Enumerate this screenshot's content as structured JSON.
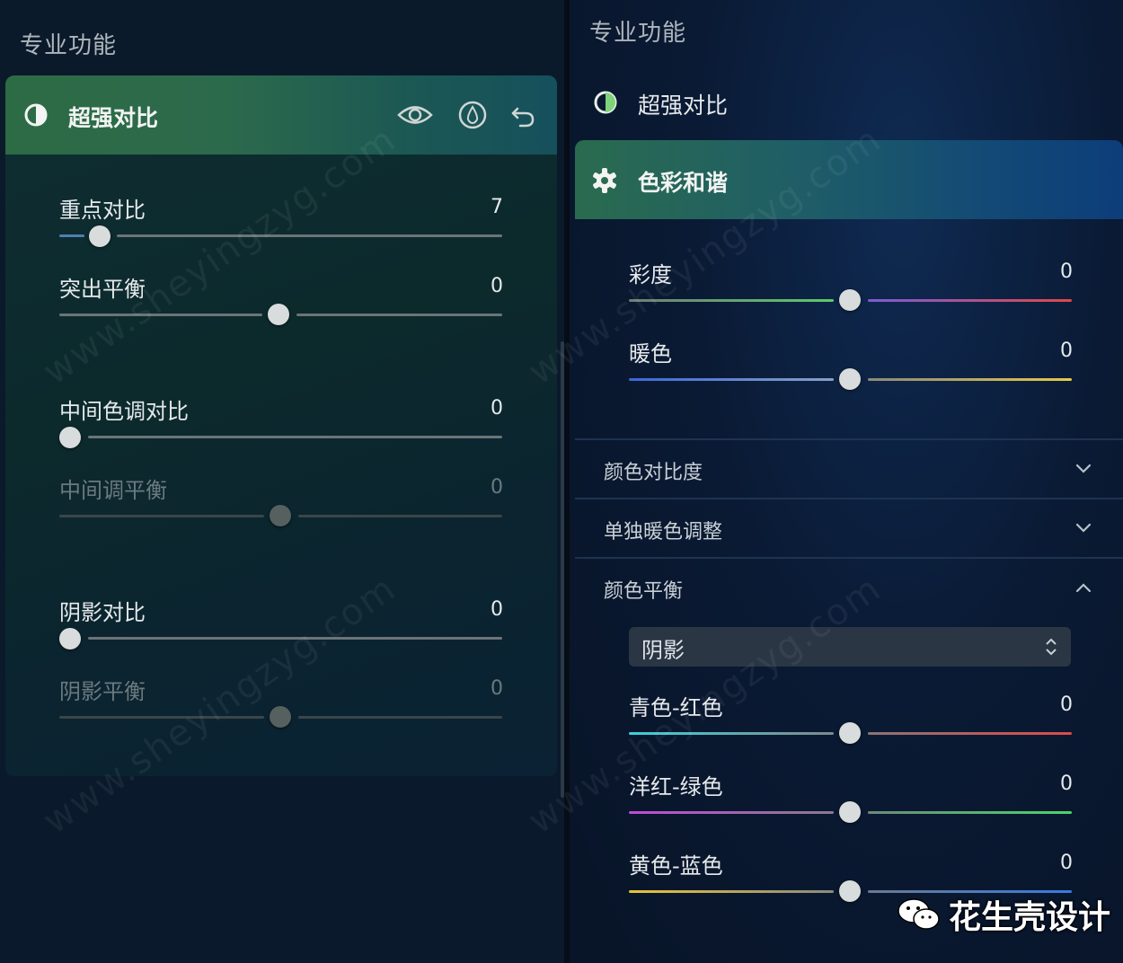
{
  "left": {
    "section_title": "专业功能",
    "panel_title": "超强对比",
    "sliders": [
      {
        "label": "重点对比",
        "value": "7",
        "enabled": true,
        "position": 0.09
      },
      {
        "label": "突出平衡",
        "value": "0",
        "enabled": true,
        "position": 0.5
      },
      {
        "label": "中间色调对比",
        "value": "0",
        "enabled": true,
        "position": 0.0
      },
      {
        "label": "中间调平衡",
        "value": "0",
        "enabled": false,
        "position": 0.5
      },
      {
        "label": "阴影对比",
        "value": "0",
        "enabled": true,
        "position": 0.0
      },
      {
        "label": "阴影平衡",
        "value": "0",
        "enabled": false,
        "position": 0.5
      }
    ],
    "icons": [
      "contrast-icon",
      "eye-icon",
      "drop-icon",
      "undo-icon"
    ]
  },
  "right": {
    "section_title": "专业功能",
    "collapsed_item": "超强对比",
    "panel_title": "色彩和谐",
    "sliders": [
      {
        "label": "彩度",
        "value": "0",
        "position": 0.5
      },
      {
        "label": "暖色",
        "value": "0",
        "position": 0.5
      }
    ],
    "accordions": [
      {
        "label": "颜色对比度",
        "state": "collapsed"
      },
      {
        "label": "单独暖色调整",
        "state": "collapsed"
      },
      {
        "label": "颜色平衡",
        "state": "expanded"
      }
    ],
    "select": {
      "value": "阴影"
    },
    "balance_sliders": [
      {
        "label": "青色-红色",
        "value": "0",
        "position": 0.5
      },
      {
        "label": "洋红-绿色",
        "value": "0",
        "position": 0.5
      },
      {
        "label": "黄色-蓝色",
        "value": "0",
        "position": 0.5
      }
    ]
  },
  "watermark": "www.sheyingzyg.com",
  "brand": "花生壳设计"
}
